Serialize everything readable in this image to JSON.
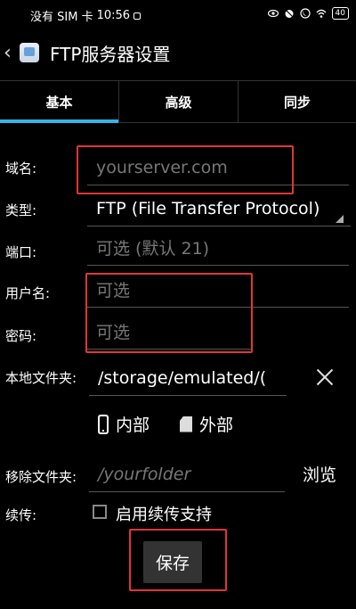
{
  "status_bar": {
    "carrier": "没有 SIM 卡",
    "time": "10:56",
    "battery": "40"
  },
  "header": {
    "title": "FTP服务器设置"
  },
  "tabs": [
    {
      "label": "基本"
    },
    {
      "label": "高级"
    },
    {
      "label": "同步"
    }
  ],
  "form": {
    "domain": {
      "label": "域名:",
      "placeholder": "yourserver.com"
    },
    "type": {
      "label": "类型:",
      "value": "FTP (File Transfer Protocol)"
    },
    "port": {
      "label": "端口:",
      "placeholder": "可选 (默认 21)"
    },
    "username": {
      "label": "用户名:",
      "placeholder": "可选"
    },
    "password": {
      "label": "密码:",
      "placeholder": "可选"
    },
    "local_folder": {
      "label": "本地文件夹:",
      "value": "/storage/emulated/("
    },
    "storage": {
      "internal": "内部",
      "external": "外部"
    },
    "remote_folder": {
      "label": "移除文件夹:",
      "placeholder": "/yourfolder",
      "browse": "浏览"
    },
    "resume": {
      "label": "续传:",
      "checkbox_label": "启用续传支持"
    },
    "save": "保存"
  },
  "colors": {
    "accent": "#33b5e5",
    "highlight": "#e0353a"
  }
}
